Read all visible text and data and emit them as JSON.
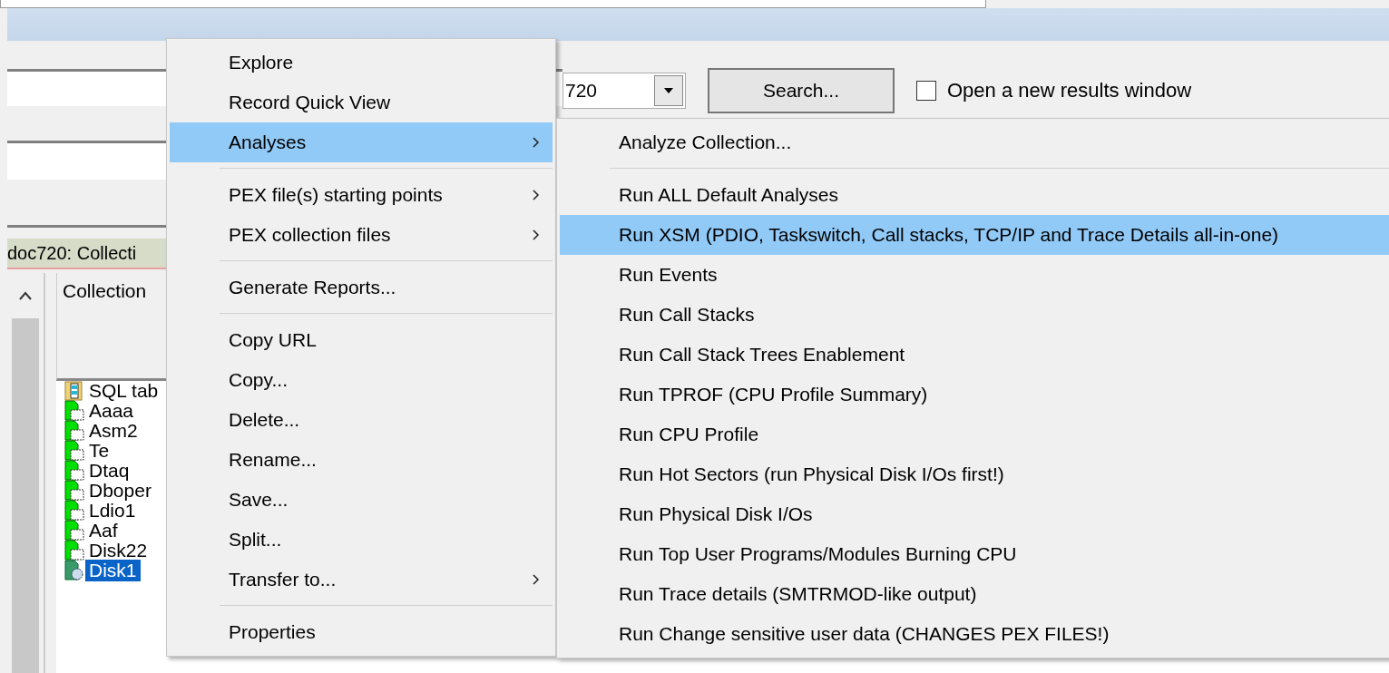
{
  "search_bar": {
    "combo_value": "720",
    "search_button": "Search...",
    "new_window_checkbox": {
      "label": "Open a new results window",
      "checked": false
    }
  },
  "status_label": "doc720:  Collecti",
  "list": {
    "header": "Collection",
    "rows": [
      {
        "name": "SQL tab",
        "kind": "sql",
        "selected": false
      },
      {
        "name": "Aaaa",
        "kind": "collection",
        "selected": false
      },
      {
        "name": "Asm2",
        "kind": "collection",
        "selected": false
      },
      {
        "name": "Te",
        "kind": "collection",
        "selected": false
      },
      {
        "name": "Dtaq",
        "kind": "collection",
        "selected": false
      },
      {
        "name": "Dboper",
        "kind": "collection",
        "selected": false
      },
      {
        "name": "Ldio1",
        "kind": "collection",
        "selected": false
      },
      {
        "name": "Aaf",
        "kind": "collection",
        "selected": false
      },
      {
        "name": "Disk22",
        "kind": "collection",
        "selected": false
      },
      {
        "name": "Disk1",
        "kind": "hatched",
        "selected": true
      }
    ]
  },
  "context_menu": [
    {
      "kind": "item",
      "label": "Explore",
      "has_submenu": false,
      "selected": false
    },
    {
      "kind": "item",
      "label": "Record Quick View",
      "has_submenu": false,
      "selected": false
    },
    {
      "kind": "item",
      "label": "Analyses",
      "has_submenu": true,
      "selected": true
    },
    {
      "kind": "separator"
    },
    {
      "kind": "item",
      "label": "PEX file(s) starting points",
      "has_submenu": true,
      "selected": false
    },
    {
      "kind": "item",
      "label": "PEX collection files",
      "has_submenu": true,
      "selected": false
    },
    {
      "kind": "separator"
    },
    {
      "kind": "item",
      "label": "Generate Reports...",
      "has_submenu": false,
      "selected": false
    },
    {
      "kind": "separator"
    },
    {
      "kind": "item",
      "label": "Copy URL",
      "has_submenu": false,
      "selected": false
    },
    {
      "kind": "item",
      "label": "Copy...",
      "has_submenu": false,
      "selected": false
    },
    {
      "kind": "item",
      "label": "Delete...",
      "has_submenu": false,
      "selected": false
    },
    {
      "kind": "item",
      "label": "Rename...",
      "has_submenu": false,
      "selected": false
    },
    {
      "kind": "item",
      "label": "Save...",
      "has_submenu": false,
      "selected": false
    },
    {
      "kind": "item",
      "label": "Split...",
      "has_submenu": false,
      "selected": false
    },
    {
      "kind": "item",
      "label": "Transfer to...",
      "has_submenu": true,
      "selected": false
    },
    {
      "kind": "separator"
    },
    {
      "kind": "item",
      "label": "Properties",
      "has_submenu": false,
      "selected": false
    }
  ],
  "analyses_submenu": [
    {
      "kind": "item",
      "label": "Analyze Collection...",
      "selected": false
    },
    {
      "kind": "separator"
    },
    {
      "kind": "item",
      "label": "Run ALL Default Analyses",
      "selected": false
    },
    {
      "kind": "item",
      "label": "Run XSM (PDIO, Taskswitch, Call stacks, TCP/IP and Trace Details all-in-one)",
      "selected": true
    },
    {
      "kind": "item",
      "label": "Run Events",
      "selected": false
    },
    {
      "kind": "item",
      "label": "Run Call Stacks",
      "selected": false
    },
    {
      "kind": "item",
      "label": "Run Call Stack Trees Enablement",
      "selected": false
    },
    {
      "kind": "item",
      "label": "Run TPROF (CPU Profile Summary)",
      "selected": false
    },
    {
      "kind": "item",
      "label": "Run CPU Profile",
      "selected": false
    },
    {
      "kind": "item",
      "label": "Run Hot Sectors (run Physical Disk I/Os first!)",
      "selected": false
    },
    {
      "kind": "item",
      "label": "Run Physical Disk I/Os",
      "selected": false
    },
    {
      "kind": "item",
      "label": "Run Top User Programs/Modules Burning CPU",
      "selected": false
    },
    {
      "kind": "item",
      "label": "Run Trace details (SMTRMOD-like output)",
      "selected": false
    },
    {
      "kind": "item",
      "label": "Run Change sensitive user data (CHANGES PEX FILES!)",
      "selected": false
    }
  ]
}
